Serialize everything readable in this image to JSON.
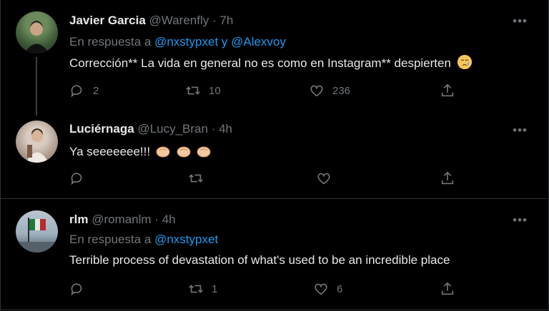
{
  "tweets": [
    {
      "name": "Javier Garcia",
      "handle": "@Warenfly",
      "time": "· 7h",
      "reply_prefix": "En respuesta a",
      "reply_mentions": "@nxstypxet y @Alexvoy",
      "text": "Corrección** La vida en general no es como en Instagram** despierten",
      "emoji": "crying-face",
      "replies": "2",
      "retweets": "10",
      "likes": "236"
    },
    {
      "name": "Luciérnaga",
      "handle": "@Lucy_Bran",
      "time": "· 4h",
      "text": "Ya seeeeeee!!!",
      "emoji": "clapping-hands",
      "replies": "",
      "retweets": "",
      "likes": ""
    },
    {
      "name": "rlm",
      "handle": "@romanlm",
      "time": "· 4h",
      "reply_prefix": "En respuesta a",
      "reply_mentions": "@nxstypxet",
      "text": "Terrible process of devastation of what's used to be an incredible place",
      "replies": "",
      "retweets": "1",
      "likes": "6"
    }
  ],
  "more_label": "•••",
  "colors": {
    "background": "#000000",
    "mention": "#1d9bf0",
    "muted": "#71767b",
    "text": "#e7e9ea"
  }
}
